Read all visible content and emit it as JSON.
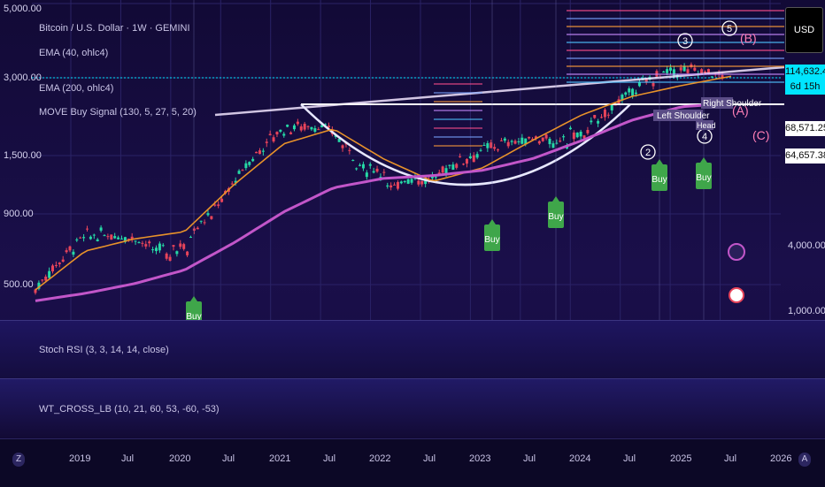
{
  "header": {
    "title": "Bitcoin / U.S. Dollar · 1W · GEMINI",
    "currency_button": "USD"
  },
  "indicators": {
    "ema1": "EMA (40, ohlc4)",
    "ema2": "EMA (200, ohlc4)",
    "move": "MOVE Buy Signal (130, 5, 27, 5, 20)",
    "stoch": "Stoch RSI (3, 3, 14, 14, close)",
    "wt": "WT_CROSS_LB (10, 21, 60, 53, -60, -53)"
  },
  "left_axis": [
    "5,000.00",
    "3,000.00",
    "1,500.00",
    "900.00",
    "500.00"
  ],
  "right_axis": [
    "4,000.00",
    "1,000.00"
  ],
  "price_tags": [
    {
      "label": "114,632.44",
      "bg": "#00e5ff",
      "fg": "#0a0a0a"
    },
    {
      "label": "6d 15h",
      "bg": "#00e5ff",
      "fg": "#0a0a0a"
    },
    {
      "label": "68,571.25",
      "bg": "#ffffff",
      "fg": "#0a0a0a"
    },
    {
      "label": "64,657.38",
      "bg": "#ffffff",
      "fg": "#0a0a0a"
    }
  ],
  "time_axis": [
    "2019",
    "Jul",
    "2020",
    "Jul",
    "2021",
    "Jul",
    "2022",
    "Jul",
    "2023",
    "Jul",
    "2024",
    "Jul",
    "2025",
    "Jul",
    "2026"
  ],
  "buttons": {
    "left": "Z",
    "right": "A"
  },
  "annotations": {
    "buy": "Buy",
    "left_shoulder": "Left Shoulder",
    "right_shoulder": "Right Shoulder",
    "head": "Head",
    "wave_2": "2",
    "wave_3": "3",
    "wave_4": "4",
    "wave_5": "5",
    "wave_a": "(A)",
    "wave_b": "(B)",
    "wave_c": "(C)"
  },
  "colors": {
    "ema40": "#e8922a",
    "ema200": "#c256c9",
    "candle_up": "#26d9a6",
    "candle_down": "#e8445a",
    "buy": "#3fa64a",
    "neckline": "#ffffff"
  },
  "chart_data": {
    "type": "line",
    "title": "Bitcoin / U.S. Dollar · 1W · GEMINI",
    "x": [
      "2019",
      "Jul",
      "2020",
      "Jul",
      "2021",
      "Jul",
      "2022",
      "Jul",
      "2023",
      "Jul",
      "2024",
      "Jul",
      "2025",
      "Jul",
      "2026"
    ],
    "yscale": "log",
    "series": [
      {
        "name": "EMA (40, ohlc4)",
        "values": [
          3800,
          7000,
          8500,
          9500,
          20000,
          38000,
          48000,
          30000,
          21000,
          26000,
          40000,
          60000,
          80000,
          95000,
          110000
        ]
      },
      {
        "name": "EMA (200, ohlc4)",
        "values": [
          3200,
          3600,
          4200,
          5200,
          8000,
          13000,
          19000,
          22000,
          23000,
          25000,
          30000,
          40000,
          55000,
          68000,
          72000
        ]
      }
    ],
    "last_price": 114632.44,
    "price_levels": [
      114632.44,
      68571.25,
      64657.38
    ],
    "buy_signals": [
      "2020",
      "2023",
      "2023",
      "2025",
      "2025"
    ]
  }
}
